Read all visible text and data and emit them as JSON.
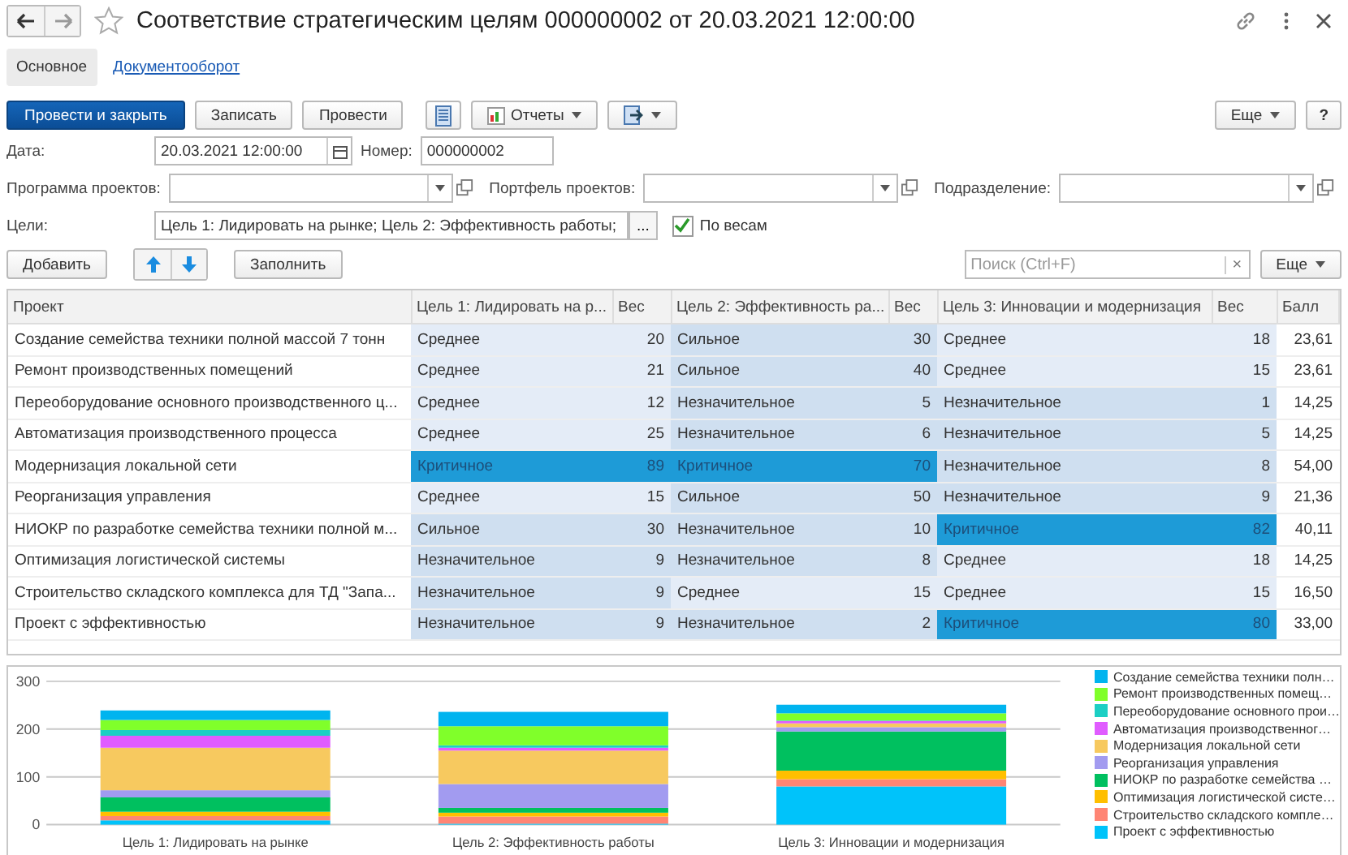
{
  "window": {
    "title": "Соответствие стратегическим целям 000000002 от 20.03.2021 12:00:00"
  },
  "tabs": [
    {
      "label": "Основное",
      "selected": true
    },
    {
      "label": "Документооборот",
      "selected": false
    }
  ],
  "toolbar": {
    "buttons": [
      {
        "label": "Провести и закрыть",
        "kind": "primary"
      },
      {
        "label": "Записать",
        "kind": "plain"
      },
      {
        "label": "Провести",
        "kind": "plain"
      }
    ],
    "reports": "Отчеты",
    "more": "Еще",
    "help": "?"
  },
  "form": {
    "date_label": "Дата:",
    "date": "20.03.2021 12:00:00",
    "number_label": "Номер:",
    "number": "000000002",
    "program_label": "Программа проектов:",
    "portfolio_label": "Портфель проектов:",
    "department_label": "Подразделение:",
    "goals_label": "Цели:",
    "goals": "Цель 1: Лидировать на рынке; Цель 2: Эффективность работы;",
    "goals_button": "...",
    "by_weights": {
      "label": "По весам",
      "checked": true
    }
  },
  "table_toolbar": {
    "add": "Добавить",
    "fill": "Заполнить",
    "search_placeholder": "Поиск (Ctrl+F)",
    "clear": "×",
    "more": "Еще"
  },
  "table": {
    "columns": [
      "Проект",
      "Цель 1: Лидировать на р...",
      "Вес",
      "Цель 2: Эффективность ра...",
      "Вес",
      "Цель 3: Инновации и модернизация",
      "Вес",
      "Балл"
    ],
    "rows": [
      {
        "project": "Создание семейства техники полной массой 7 тонн",
        "goals": [
          {
            "rating": "Среднее",
            "weight": "20",
            "color": "#e4ecf7"
          },
          {
            "rating": "Сильное",
            "weight": "30",
            "color": "#cfdff0"
          },
          {
            "rating": "Среднее",
            "weight": "18",
            "color": "#e4ecf7"
          }
        ],
        "score": "23,61"
      },
      {
        "project": "Ремонт производственных помещений",
        "goals": [
          {
            "rating": "Среднее",
            "weight": "21",
            "color": "#e4ecf7"
          },
          {
            "rating": "Сильное",
            "weight": "40",
            "color": "#cfdff0"
          },
          {
            "rating": "Среднее",
            "weight": "15",
            "color": "#e4ecf7"
          }
        ],
        "score": "23,61"
      },
      {
        "project": "Переоборудование основного производственного ц...",
        "goals": [
          {
            "rating": "Среднее",
            "weight": "12",
            "color": "#e4ecf7"
          },
          {
            "rating": "Незначительное",
            "weight": "5",
            "color": "#cfdff0"
          },
          {
            "rating": "Незначительное",
            "weight": "1",
            "color": "#cfdff0"
          }
        ],
        "score": "14,25"
      },
      {
        "project": "Автоматизация производственного процесса",
        "goals": [
          {
            "rating": "Среднее",
            "weight": "25",
            "color": "#e4ecf7"
          },
          {
            "rating": "Незначительное",
            "weight": "6",
            "color": "#cfdff0"
          },
          {
            "rating": "Незначительное",
            "weight": "5",
            "color": "#cfdff0"
          }
        ],
        "score": "14,25"
      },
      {
        "project": "Модернизация локальной сети",
        "goals": [
          {
            "rating": "Критичное",
            "weight": "89",
            "color": "#1e9bd7"
          },
          {
            "rating": "Критичное",
            "weight": "70",
            "color": "#1e9bd7"
          },
          {
            "rating": "Незначительное",
            "weight": "8",
            "color": "#cfdff0"
          }
        ],
        "score": "54,00"
      },
      {
        "project": "Реорганизация управления",
        "goals": [
          {
            "rating": "Среднее",
            "weight": "15",
            "color": "#e4ecf7"
          },
          {
            "rating": "Сильное",
            "weight": "50",
            "color": "#cfdff0"
          },
          {
            "rating": "Незначительное",
            "weight": "9",
            "color": "#cfdff0"
          }
        ],
        "score": "21,36"
      },
      {
        "project": "НИОКР по разработке семейства техники полной м...",
        "goals": [
          {
            "rating": "Сильное",
            "weight": "30",
            "color": "#cfdff0"
          },
          {
            "rating": "Незначительное",
            "weight": "10",
            "color": "#cfdff0"
          },
          {
            "rating": "Критичное",
            "weight": "82",
            "color": "#1e9bd7"
          }
        ],
        "score": "40,11"
      },
      {
        "project": "Оптимизация логистической системы",
        "goals": [
          {
            "rating": "Незначительное",
            "weight": "9",
            "color": "#cfdff0"
          },
          {
            "rating": "Незначительное",
            "weight": "8",
            "color": "#cfdff0"
          },
          {
            "rating": "Среднее",
            "weight": "18",
            "color": "#e4ecf7"
          }
        ],
        "score": "14,25"
      },
      {
        "project": "Строительство складского комплекса для ТД \"Запа...",
        "goals": [
          {
            "rating": "Незначительное",
            "weight": "9",
            "color": "#cfdff0"
          },
          {
            "rating": "Среднее",
            "weight": "15",
            "color": "#e4ecf7"
          },
          {
            "rating": "Среднее",
            "weight": "15",
            "color": "#e4ecf7"
          }
        ],
        "score": "16,50"
      },
      {
        "project": "Проект с эффективностью",
        "goals": [
          {
            "rating": "Незначительное",
            "weight": "9",
            "color": "#cfdff0"
          },
          {
            "rating": "Незначительное",
            "weight": "2",
            "color": "#cfdff0"
          },
          {
            "rating": "Критичное",
            "weight": "80",
            "color": "#1e9bd7"
          }
        ],
        "score": "33,00"
      }
    ]
  },
  "chart": {
    "chart_data": {
      "type": "bar",
      "stacked": true,
      "categories": [
        "Цель 1: Лидировать на рынке",
        "Цель 2: Эффективность работы",
        "Цель 3: Инновации и модернизация"
      ],
      "ylim": [
        0,
        300
      ],
      "yticks": [
        0,
        100,
        200,
        300
      ],
      "series": [
        {
          "name": "Проект с эффективностью",
          "color": "#00c3fa",
          "values": [
            9,
            2,
            80
          ]
        },
        {
          "name": "Строительство складского компле…",
          "color": "#ff8574",
          "values": [
            9,
            15,
            15
          ]
        },
        {
          "name": "Оптимизация логистической систе…",
          "color": "#ffbf00",
          "values": [
            9,
            8,
            18
          ]
        },
        {
          "name": "НИОКР по разработке семейства …",
          "color": "#00c05f",
          "values": [
            30,
            10,
            82
          ]
        },
        {
          "name": "Реорганизация управления",
          "color": "#a29bf0",
          "values": [
            15,
            50,
            9
          ]
        },
        {
          "name": "Модернизация локальной сети",
          "color": "#f7c95f",
          "values": [
            89,
            70,
            8
          ]
        },
        {
          "name": "Автоматизация производственног…",
          "color": "#e05cff",
          "values": [
            25,
            6,
            5
          ]
        },
        {
          "name": "Переоборудование основного прои…",
          "color": "#1ccfc4",
          "values": [
            12,
            5,
            1
          ]
        },
        {
          "name": "Ремонт производственных помещ…",
          "color": "#80ff2a",
          "values": [
            21,
            40,
            15
          ]
        },
        {
          "name": "Создание семейства техники полн…",
          "color": "#00b4ef",
          "values": [
            20,
            30,
            18
          ]
        }
      ]
    }
  }
}
